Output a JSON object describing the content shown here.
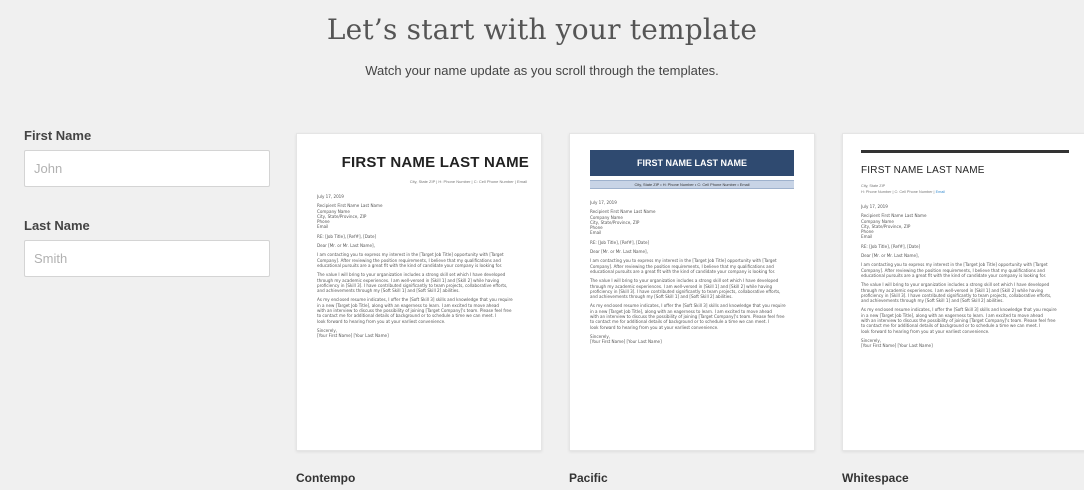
{
  "hero": {
    "title": "Let’s start with your template",
    "subtitle": "Watch your name update as you scroll through the templates."
  },
  "form": {
    "first_name_label": "First Name",
    "first_name_placeholder": "John",
    "last_name_label": "Last Name",
    "last_name_placeholder": "Smith"
  },
  "letter": {
    "date": "July 17, 2019",
    "recipient": "Recipient First Name Last Name",
    "company": "Company Name",
    "city": "City, State/Province, ZIP",
    "phone": "Phone",
    "email": "Email",
    "re": "RE: [Job Title], [Ref#], [Date]",
    "greeting": "Dear [Mr. or Mr. Last Name],",
    "p1": [
      "I am contacting you to express my interest in the [Target Job Title] opportunity with [Target",
      "Company]. After reviewing the position requirements, I believe that my qualifications and",
      "educational pursuits are a great fit with the kind of candidate your company is looking for."
    ],
    "p2": [
      "The value I will bring to your organization includes a strong skill set which I have developed",
      "through my academic experiences. I am well-versed in [Skill 1] and [Skill 2] while having",
      "proficiency in [Skill 3]. I have contributed significantly to team projects, collaborative efforts,",
      "and achievements through my [Soft Skill 1] and [Soft Skill 2] abilities."
    ],
    "p3": [
      "As my enclosed resume indicates, I offer the [Soft Skill 3] skills and knowledge that you require",
      "in a new [Target Job Title], along with an eagerness to learn. I am excited to move ahead",
      "with an interview to discuss the possibility of joining [Target Company]'s team. Please feel free",
      "to contact me for additional details of background or to schedule a time we can meet. I",
      "look forward to hearing from you at your earliest convenience."
    ],
    "closing": "Sincerely,",
    "signature": "[Your First Name] [Your Last Name]"
  },
  "templates": {
    "contempo": {
      "label": "Contempo",
      "name": "FIRST NAME LAST NAME",
      "contact": "City, State ZIP | H: Phone Number | C: Cell Phone Number | Email"
    },
    "pacific": {
      "label": "Pacific",
      "name": "FIRST NAME LAST NAME",
      "contact": "City, State ZIP • H: Phone Number • C: Cell Phone Number • Email"
    },
    "whitespace": {
      "label": "Whitespace",
      "name": "FIRST NAME LAST NAME",
      "contact_line1": "City, State ZIP",
      "contact_line2": "H: Phone Number | C: Cell Phone Number | ",
      "contact_email": "Email"
    }
  },
  "colors": {
    "background": "#f0f0f0",
    "pacific_banner": "#2f4a70",
    "pacific_contact_bar": "#c8d4e6"
  }
}
